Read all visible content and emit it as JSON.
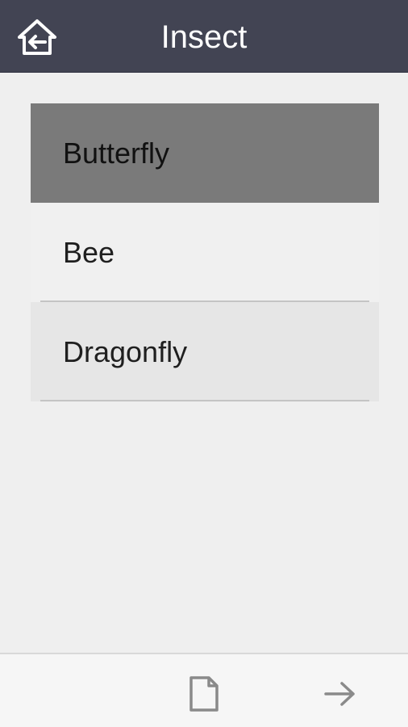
{
  "header": {
    "title": "Insect",
    "back_icon": "home-back-icon",
    "background": "#424453"
  },
  "list": {
    "items": [
      {
        "label": "Butterfly",
        "selected": true
      },
      {
        "label": "Bee",
        "selected": false
      },
      {
        "label": "Dragonfly",
        "selected": false
      }
    ]
  },
  "footer": {
    "document_icon": "document-icon",
    "next_icon": "arrow-right-icon"
  },
  "colors": {
    "selected_item": "#7a7a7a",
    "page_background": "#efefef"
  }
}
